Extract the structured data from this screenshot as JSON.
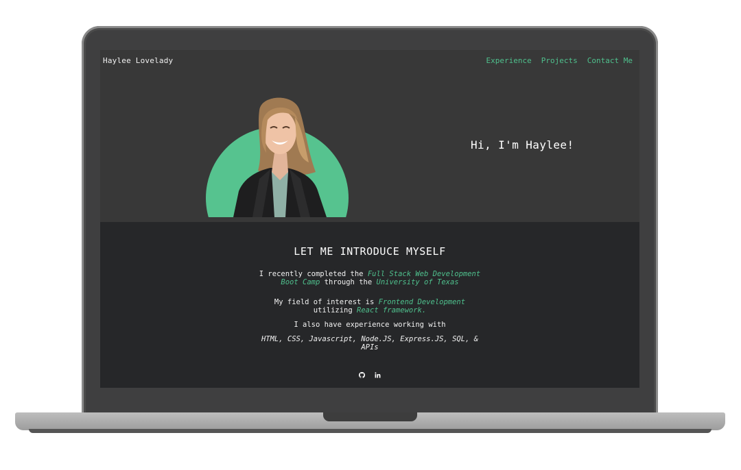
{
  "header": {
    "brand": "Haylee Lovelady",
    "nav": [
      {
        "label": "Experience"
      },
      {
        "label": "Projects"
      },
      {
        "label": "Contact Me"
      }
    ]
  },
  "hero": {
    "greeting": "Hi, I'm Haylee!"
  },
  "about": {
    "heading": "LET ME INTRODUCE MYSELF",
    "p1": {
      "a": "I recently completed the",
      "b": "Full Stack Web Development Boot Camp",
      "c": "through the",
      "d": "University of Texas"
    },
    "p2": {
      "a": "My field of interest is",
      "b": "Frontend Development",
      "c": "utilizing",
      "d": "React framework."
    },
    "p3": "I also have experience working with",
    "skills": "HTML, CSS, Javascript, Node.JS, Express.JS, SQL, & APIs"
  },
  "socials": [
    {
      "icon": "github-icon"
    },
    {
      "icon": "linkedin-icon"
    }
  ],
  "colors": {
    "accent": "#4fc08d",
    "avatar_circle": "#56c38f",
    "hero_bg": "#383838",
    "about_bg": "#262729"
  }
}
